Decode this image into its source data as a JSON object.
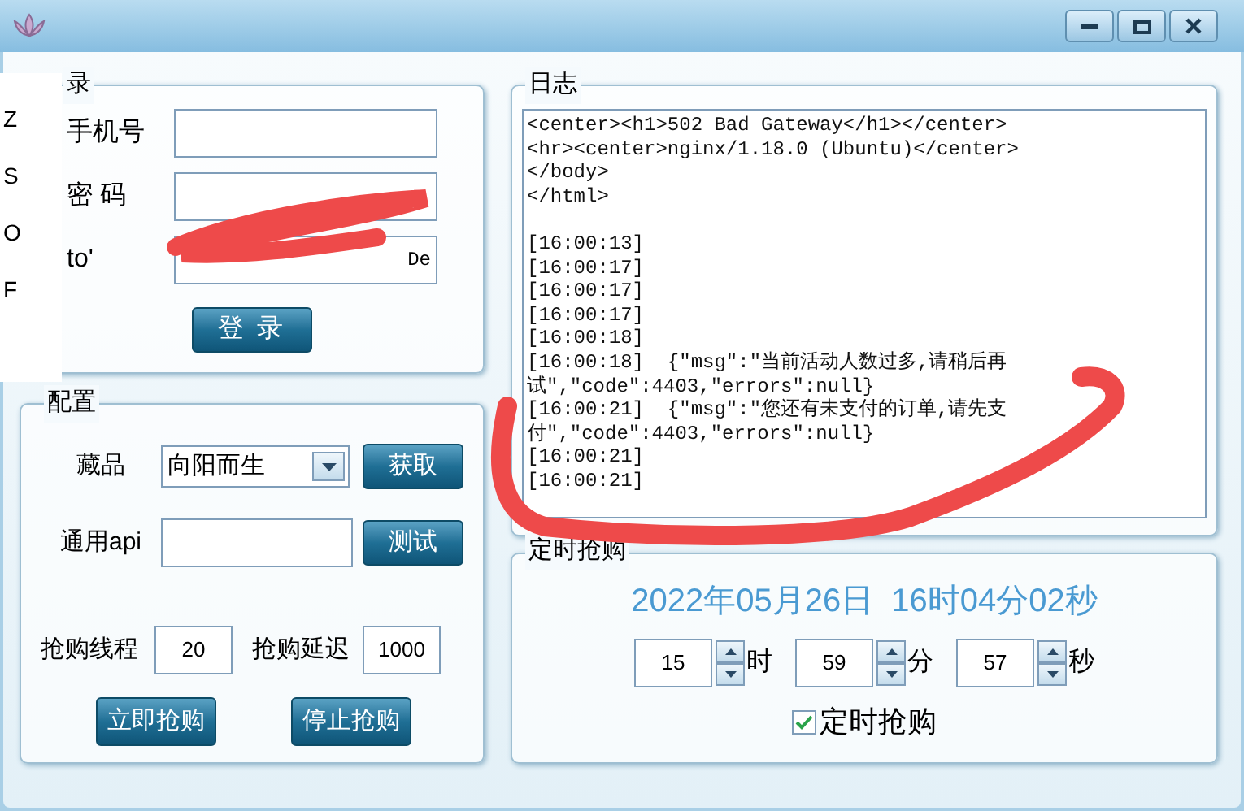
{
  "side_strip": {
    "letters": [
      "Z",
      "S",
      "O",
      "F"
    ]
  },
  "login": {
    "title": "录",
    "fields": [
      {
        "label": "手机号"
      },
      {
        "label": "密 码"
      },
      {
        "label": "to'",
        "value": "De"
      }
    ],
    "button": "登 录"
  },
  "config": {
    "title": "配置",
    "item": {
      "label": "藏品",
      "value": "向阳而生",
      "button": "获取"
    },
    "api": {
      "label": "通用api",
      "button": "测试"
    },
    "threads": {
      "label": "抢购线程",
      "value": "20"
    },
    "delay": {
      "label": "抢购延迟",
      "value": "1000"
    },
    "buttons": [
      "立即抢购",
      "停止抢购"
    ]
  },
  "log": {
    "title": "日志",
    "blocks": [
      [
        "<center><h1>502 Bad Gateway</h1></center>",
        "<hr><center>nginx/1.18.0 (Ubuntu)</center>",
        "</body>",
        "</html>"
      ],
      [
        "[16:00:13]",
        "[16:00:17]",
        "[16:00:17]",
        "[16:00:17]",
        "[16:00:18]",
        "[16:00:18]  {\"msg\":\"当前活动人数过多,请稍后再",
        "试\",\"code\":4403,\"errors\":null}",
        "[16:00:21]  {\"msg\":\"您还有未支付的订单,请先支",
        "付\",\"code\":4403,\"errors\":null}",
        "[16:00:21]",
        "[16:00:21]"
      ]
    ]
  },
  "timer": {
    "title": "定时抢购",
    "clock": "2022年05月26日  16时04分02秒",
    "spinners": [
      {
        "value": "15",
        "unit": "时"
      },
      {
        "value": "59",
        "unit": "分"
      },
      {
        "value": "57",
        "unit": "秒"
      }
    ],
    "checkbox": {
      "label": "定时抢购",
      "checked": true
    }
  }
}
